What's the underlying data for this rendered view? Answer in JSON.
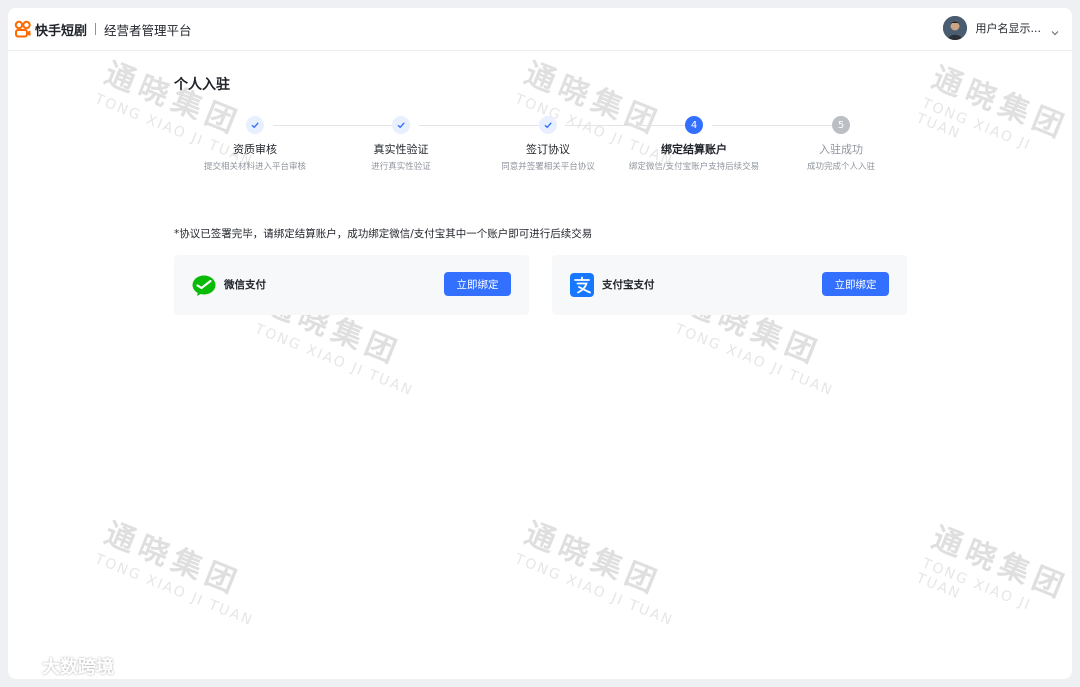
{
  "header": {
    "brand_name": "快手短剧",
    "brand_sub": "经营者管理平台",
    "user_name": "用户名显示..."
  },
  "page": {
    "title": "个人入驻"
  },
  "steps": [
    {
      "title": "资质审核",
      "desc": "提交相关材料进入平台审核",
      "status": "done"
    },
    {
      "title": "真实性验证",
      "desc": "进行真实性验证",
      "status": "done"
    },
    {
      "title": "签订协议",
      "desc": "同意并签署相关平台协议",
      "status": "done"
    },
    {
      "title": "绑定结算账户",
      "desc": "绑定微信/支付宝账户支持后续交易",
      "status": "current",
      "number": "4"
    },
    {
      "title": "入驻成功",
      "desc": "成功完成个人入驻",
      "status": "todo",
      "number": "5"
    }
  ],
  "notice": "*协议已签署完毕，请绑定结算账户，成功绑定微信/支付宝其中一个账户即可进行后续交易",
  "payments": [
    {
      "label": "微信支付",
      "button": "立即绑定",
      "icon": "wechat-pay-icon",
      "color": "#09bb07"
    },
    {
      "label": "支付宝支付",
      "button": "立即绑定",
      "icon": "alipay-icon",
      "color": "#1677ff"
    }
  ],
  "watermark": {
    "cn": "通晓集团",
    "en": "TONG XIAO JI TUAN"
  },
  "corner_mark": "大数跨境",
  "colors": {
    "primary": "#3370ff",
    "brand": "#fe3666"
  }
}
